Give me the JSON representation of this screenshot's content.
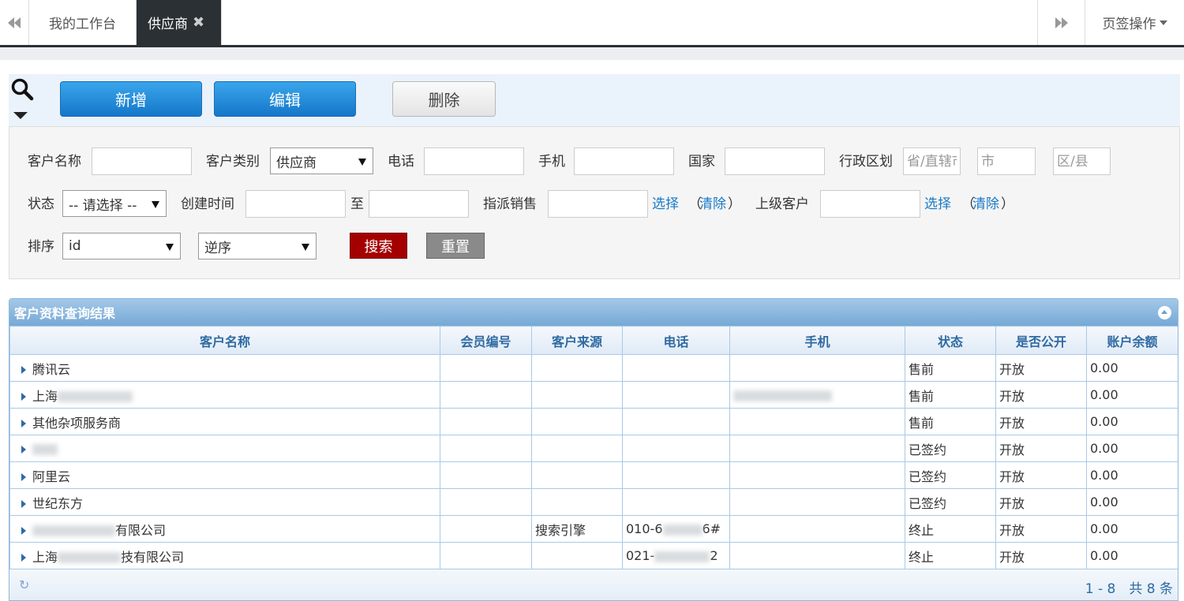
{
  "tabs": {
    "workbench": "我的工作台",
    "supplier": "供应商",
    "close_glyph": "✖",
    "page_ops": "页签操作"
  },
  "toolbar": {
    "add": "新增",
    "edit": "编辑",
    "delete": "删除"
  },
  "filters": {
    "customer_name_label": "客户名称",
    "customer_type_label": "客户类别",
    "customer_type_value": "供应商",
    "phone_label": "电话",
    "mobile_label": "手机",
    "country_label": "国家",
    "region_label": "行政区划",
    "province_placeholder": "省/直辖市",
    "city_placeholder": "市",
    "district_placeholder": "区/县",
    "status_label": "状态",
    "status_value": "-- 请选择 --",
    "created_label": "创建时间",
    "to_label": "至",
    "sales_label": "指派销售",
    "select_link": "选择",
    "clear_link": "清除",
    "lparen": "（",
    "rparen": "）",
    "parent_label": "上级客户",
    "sort_label": "排序",
    "sort_field": "id",
    "sort_order": "逆序",
    "search_btn": "搜索",
    "reset_btn": "重置"
  },
  "grid": {
    "title": "客户资料查询结果",
    "columns": [
      "客户名称",
      "会员编号",
      "客户来源",
      "电话",
      "手机",
      "状态",
      "是否公开",
      "账户余额"
    ],
    "rows": [
      {
        "name": "腾讯云",
        "member": "",
        "source": "",
        "phone": "",
        "mobile": "",
        "status": "售前",
        "public": "开放",
        "balance": "0.00"
      },
      {
        "name": "上海",
        "member": "",
        "source": "",
        "phone": "",
        "mobile": "",
        "status": "售前",
        "public": "开放",
        "balance": "0.00"
      },
      {
        "name": "其他杂项服务商",
        "member": "",
        "source": "",
        "phone": "",
        "mobile": "",
        "status": "售前",
        "public": "开放",
        "balance": "0.00"
      },
      {
        "name": "",
        "member": "",
        "source": "",
        "phone": "",
        "mobile": "",
        "status": "已签约",
        "public": "开放",
        "balance": "0.00"
      },
      {
        "name": "阿里云",
        "member": "",
        "source": "",
        "phone": "",
        "mobile": "",
        "status": "已签约",
        "public": "开放",
        "balance": "0.00"
      },
      {
        "name": "世纪东方",
        "member": "",
        "source": "",
        "phone": "",
        "mobile": "",
        "status": "已签约",
        "public": "开放",
        "balance": "0.00"
      },
      {
        "name": "有限公司",
        "member": "",
        "source": "搜索引擎",
        "phone": "010-6",
        "phone_tail": "6#",
        "mobile": "",
        "status": "终止",
        "public": "开放",
        "balance": "0.00"
      },
      {
        "name": "上海",
        "name_tail": "技有限公司",
        "member": "",
        "source": "",
        "phone": "021-",
        "phone_tail": "2",
        "mobile": "",
        "status": "终止",
        "public": "开放",
        "balance": "0.00"
      }
    ],
    "pager": "1 - 8　共 8 条"
  }
}
